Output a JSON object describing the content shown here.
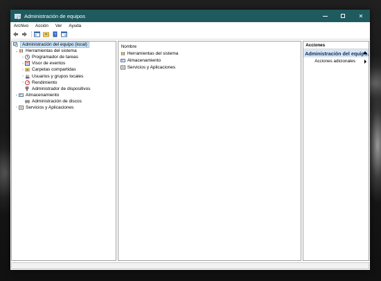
{
  "window": {
    "title": "Administración de equipos"
  },
  "menu": [
    "Archivo",
    "Acción",
    "Ver",
    "Ayuda"
  ],
  "tree": {
    "root": "Administración del equipo (local)",
    "system_tools": "Herramientas del sistema",
    "task_scheduler": "Programador de tareas",
    "event_viewer": "Visor de eventos",
    "shared_folders": "Carpetas compartidas",
    "local_users": "Usuarios y grupos locales",
    "performance": "Rendimiento",
    "device_manager": "Administrador de dispositivos",
    "storage": "Almacenamiento",
    "disk_management": "Administración de discos",
    "services": "Servicios y Aplicaciones"
  },
  "list": {
    "header": "Nombre",
    "items": [
      "Herramientas del sistema",
      "Almacenamiento",
      "Servicios y Aplicaciones"
    ]
  },
  "actions": {
    "header": "Acciones",
    "section": "Administración del equipo...",
    "more": "Acciones adicionales"
  },
  "colors": {
    "titlebar": "#1f5a5e",
    "selection": "#cce4f7",
    "actions_section": "#d6e6f5"
  }
}
